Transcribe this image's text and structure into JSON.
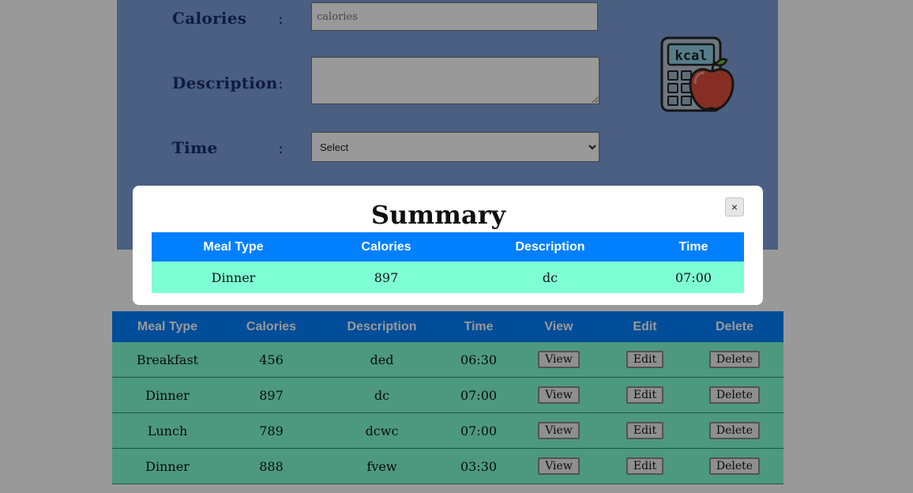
{
  "form": {
    "calories_label": "Calories",
    "calories_placeholder": "calories",
    "description_label": "Description",
    "time_label": "Time",
    "colon": ":",
    "time_select": {
      "selected": "Select"
    },
    "logo_text": "kcal"
  },
  "meals": {
    "headers": [
      "Meal Type",
      "Calories",
      "Description",
      "Time",
      "View",
      "Edit",
      "Delete"
    ],
    "button_labels": {
      "view": "View",
      "edit": "Edit",
      "delete": "Delete"
    },
    "rows": [
      {
        "meal_type": "Breakfast",
        "calories": "456",
        "description": "ded",
        "time": "06:30"
      },
      {
        "meal_type": "Dinner",
        "calories": "897",
        "description": "dc",
        "time": "07:00"
      },
      {
        "meal_type": "Lunch",
        "calories": "789",
        "description": "dcwc",
        "time": "07:00"
      },
      {
        "meal_type": "Dinner",
        "calories": "888",
        "description": "fvew",
        "time": "03:30"
      }
    ]
  },
  "modal": {
    "title": "Summary",
    "close_label": "×",
    "headers": [
      "Meal Type",
      "Calories",
      "Description",
      "Time"
    ],
    "row": {
      "meal_type": "Dinner",
      "calories": "897",
      "description": "dc",
      "time": "07:00"
    }
  },
  "colors": {
    "form_bg": "#7c9fd8",
    "table_header": "#0080ff",
    "table_row": "#7fffd4",
    "overlay": "rgba(0,0,0,0.4)"
  }
}
